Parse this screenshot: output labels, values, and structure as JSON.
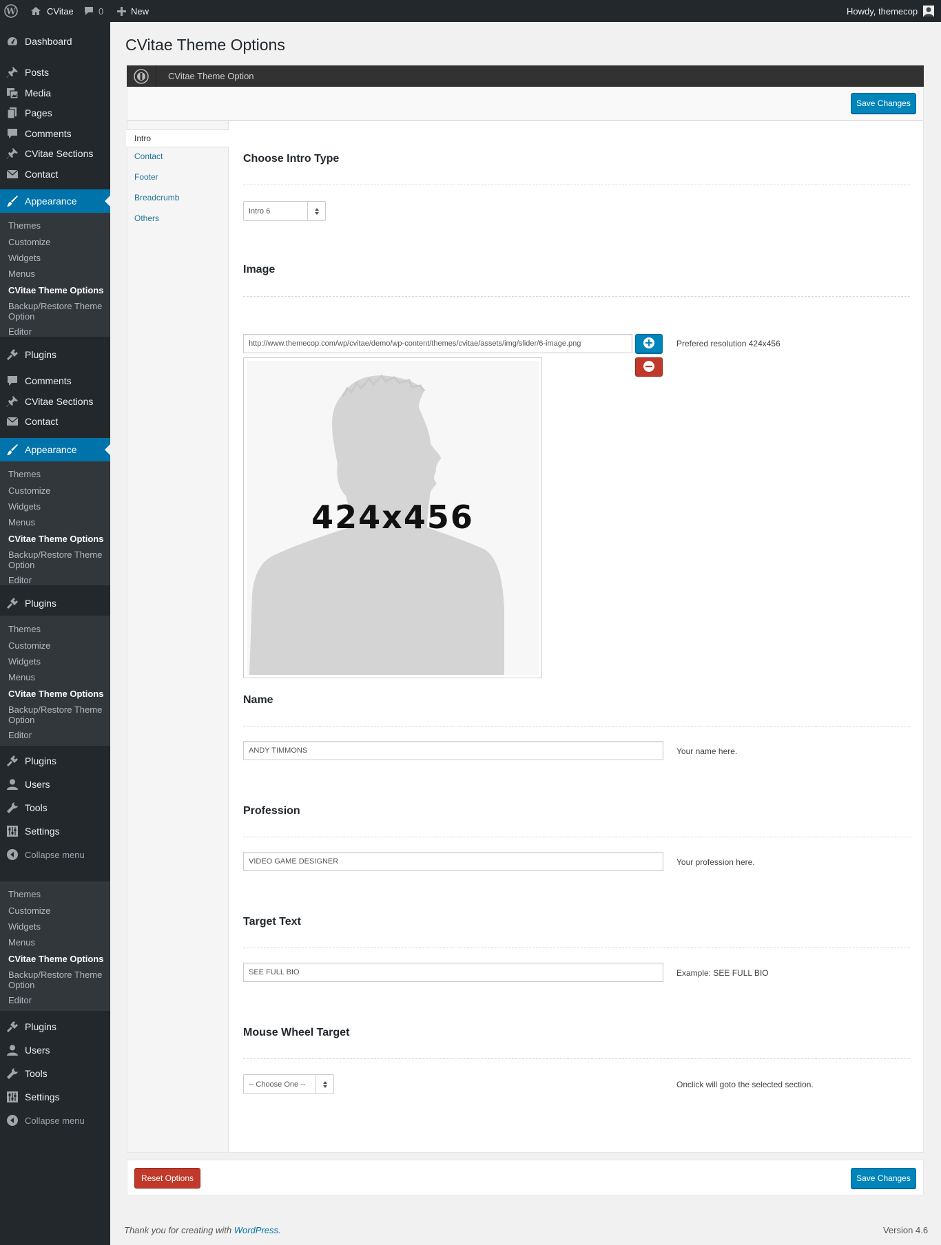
{
  "admin_bar": {
    "site_name": "CVitae",
    "comments_count": "0",
    "new_label": "New",
    "howdy": "Howdy, themecop"
  },
  "sidebar": {
    "dashboard": "Dashboard",
    "posts": "Posts",
    "media": "Media",
    "pages": "Pages",
    "comments": "Comments",
    "cvitae_sections": "CVitae Sections",
    "contact": "Contact",
    "appearance": "Appearance",
    "plugins": "Plugins",
    "users": "Users",
    "tools": "Tools",
    "settings": "Settings",
    "collapse": "Collapse menu",
    "sub": {
      "themes": "Themes",
      "customize": "Customize",
      "widgets": "Widgets",
      "menus": "Menus",
      "cvitae_options": "CVitae Theme Options",
      "backup": "Backup/Restore Theme Option",
      "editor": "Editor"
    }
  },
  "page": {
    "title": "CVitae Theme Options",
    "panel_title": "CVitae Theme Option",
    "save_label": "Save Changes",
    "reset_label": "Reset Options"
  },
  "tabs": [
    "Intro",
    "Contact",
    "Footer",
    "Breadcrumb",
    "Others"
  ],
  "fields": {
    "intro_type": {
      "title": "Choose Intro Type",
      "value": "Intro 6"
    },
    "image": {
      "title": "Image",
      "url": "http://www.themecop.com/wp/cvitae/demo/wp-content/themes/cvitae/assets/img/slider/6-image.png",
      "desc": "Prefered resolution 424x456",
      "preview_text": "424x456"
    },
    "name": {
      "title": "Name",
      "value": "ANDY TIMMONS",
      "desc": "Your name here."
    },
    "profession": {
      "title": "Profession",
      "value": "VIDEO GAME DESIGNER",
      "desc": "Your profession here."
    },
    "target_text": {
      "title": "Target Text",
      "value": "SEE FULL BIO",
      "desc": "Example: SEE FULL BIO"
    },
    "mouse_wheel": {
      "title": "Mouse Wheel Target",
      "value": "-- Choose One --",
      "desc": "Onclick will goto the selected section."
    }
  },
  "footer": {
    "thanks_prefix": "Thank you for creating with",
    "thanks_link": "WordPress",
    "thanks_suffix": ".",
    "version": "Version 4.6"
  },
  "colors": {
    "admin_dark": "#23282d",
    "submenu_bg": "#32373c",
    "accent_blue": "#0073aa",
    "button_blue": "#0085ba",
    "button_red": "#c0392b"
  }
}
